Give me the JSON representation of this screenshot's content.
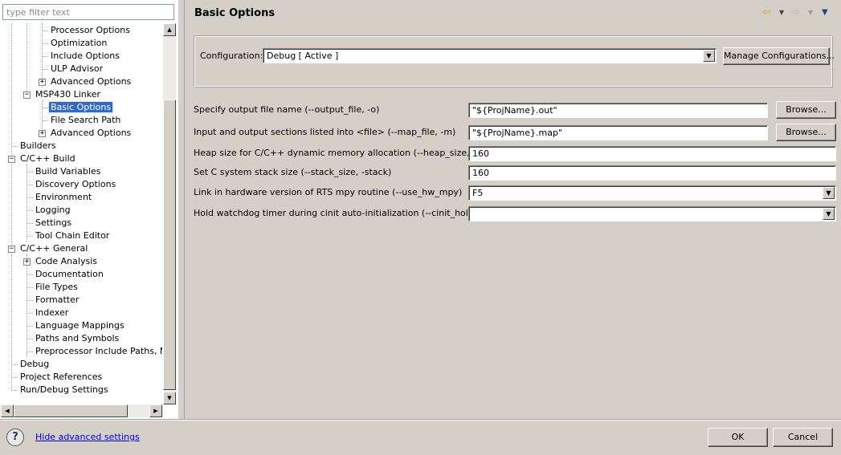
{
  "filter": {
    "placeholder": "type filter text"
  },
  "tree": {
    "items": [
      {
        "label": "Processor Options"
      },
      {
        "label": "Optimization"
      },
      {
        "label": "Include Options"
      },
      {
        "label": "ULP Advisor"
      },
      {
        "label": "Advanced Options"
      },
      {
        "label": "MSP430 Linker"
      },
      {
        "label": "Basic Options",
        "selected": true
      },
      {
        "label": "File Search Path"
      },
      {
        "label": "Advanced Options"
      },
      {
        "label": "Builders"
      },
      {
        "label": "C/C++ Build"
      },
      {
        "label": "Build Variables"
      },
      {
        "label": "Discovery Options"
      },
      {
        "label": "Environment"
      },
      {
        "label": "Logging"
      },
      {
        "label": "Settings"
      },
      {
        "label": "Tool Chain Editor"
      },
      {
        "label": "C/C++ General"
      },
      {
        "label": "Code Analysis"
      },
      {
        "label": "Documentation"
      },
      {
        "label": "File Types"
      },
      {
        "label": "Formatter"
      },
      {
        "label": "Indexer"
      },
      {
        "label": "Language Mappings"
      },
      {
        "label": "Paths and Symbols"
      },
      {
        "label": "Preprocessor Include Paths, Mac"
      },
      {
        "label": "Debug"
      },
      {
        "label": "Project References"
      },
      {
        "label": "Run/Debug Settings"
      }
    ]
  },
  "page": {
    "title": "Basic Options",
    "configuration_label": "Configuration:",
    "configuration_value": "Debug  [ Active ]",
    "manage_button": "Manage Configurations..."
  },
  "options": {
    "output_file": {
      "label": "Specify output file name (--output_file, -o)",
      "value": "\"${ProjName}.out\"",
      "browse": "Browse..."
    },
    "map_file": {
      "label": "Input and output sections listed into <file> (--map_file, -m)",
      "value": "\"${ProjName}.map\"",
      "browse": "Browse..."
    },
    "heap_size": {
      "label": "Heap size for C/C++ dynamic memory allocation (--heap_size, -heap)",
      "value": "160"
    },
    "stack_size": {
      "label": "Set C system stack size (--stack_size, -stack)",
      "value": "160"
    },
    "hw_mpy": {
      "label": "Link in hardware version of RTS mpy routine (--use_hw_mpy)",
      "value": "F5"
    },
    "cinit_hold_wdt": {
      "label": "Hold watchdog timer during cinit auto-initialization (--cinit_hold_wdt)",
      "value": ""
    }
  },
  "footer": {
    "help_glyph": "?",
    "advanced_link": "Hide advanced settings",
    "ok": "OK",
    "cancel": "Cancel"
  },
  "icons": {
    "back": "back-arrow-icon",
    "forward": "forward-arrow-icon",
    "menu": "view-menu-icon",
    "selection_color": "#316ac5",
    "link_color": "#0000ee"
  }
}
